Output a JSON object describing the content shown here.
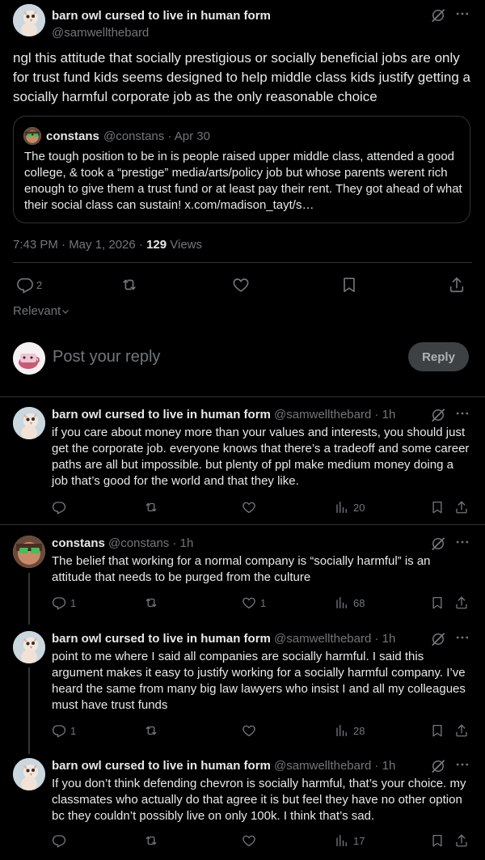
{
  "main_post": {
    "author_name": "barn owl cursed to live in human form",
    "author_handle": "@samwellthebard",
    "text": "ngl this attitude that socially prestigious or socially beneficial jobs are only for trust fund kids seems designed to help middle class kids justify getting a socially harmful corporate job as the only reasonable choice",
    "quote": {
      "author_name": "constans",
      "author_handle": "@constans",
      "date": "Apr 30",
      "text": "The tough position to be in is people raised upper middle class, attended a good college, & took a “prestige” media/arts/policy job but whose parents werent rich enough to give them  a trust fund or at least pay their rent. They got ahead of what their social class can sustain! x.com/madison_tayt/s…"
    },
    "timestamp": "7:43 PM · May 1, 2026 · ",
    "views_count": "129",
    "views_label": " Views",
    "reply_count": "2",
    "sort_label": "Relevant"
  },
  "reply_box": {
    "placeholder": "Post your reply",
    "button_label": "Reply"
  },
  "replies": [
    {
      "author_name": "barn owl cursed to live in human form",
      "author_handle": "@samwellthebard · 1h",
      "text": "if you care about money more than your values and interests, you should just get the corporate job. everyone knows that there’s a tradeoff and some career paths are all but impossible. but plenty of ppl make medium money doing a job that’s good for the world and that they like.",
      "replies": "",
      "likes": "",
      "views": "20"
    },
    {
      "author_name": "constans",
      "author_handle": "@constans · 1h",
      "text": "The belief that working for a normal company is “socially harmful” is an attitude that needs to be purged from the culture",
      "replies": "1",
      "likes": "1",
      "views": "68"
    },
    {
      "author_name": "barn owl cursed to live in human form",
      "author_handle": "@samwellthebard · 1h",
      "text": "point to me where I said all companies are socially harmful. I said this argument makes it easy to justify working for a socially harmful company. I’ve heard the same from many big law lawyers who insist I and all my colleagues must have trust funds",
      "replies": "1",
      "likes": "",
      "views": "28"
    },
    {
      "author_name": "barn owl cursed to live in human form",
      "author_handle": "@samwellthebard · 1h",
      "text": "If you don’t think defending chevron is socially harmful, that’s your choice. my classmates who actually do that agree it is but feel they have no other option bc they couldn’t possibly live on only 100k. I think that’s sad.",
      "replies": "",
      "likes": "",
      "views": "17"
    }
  ],
  "icons": [
    "grok-icon",
    "more-icon",
    "reply-icon",
    "retweet-icon",
    "like-icon",
    "bookmark-icon",
    "share-icon",
    "views-icon",
    "chevron-down-icon"
  ],
  "colors": {
    "background": "#000000",
    "text": "#e7e9ea",
    "secondary": "#71767b",
    "border": "#2f3336",
    "reply_button": "#3e4144"
  }
}
